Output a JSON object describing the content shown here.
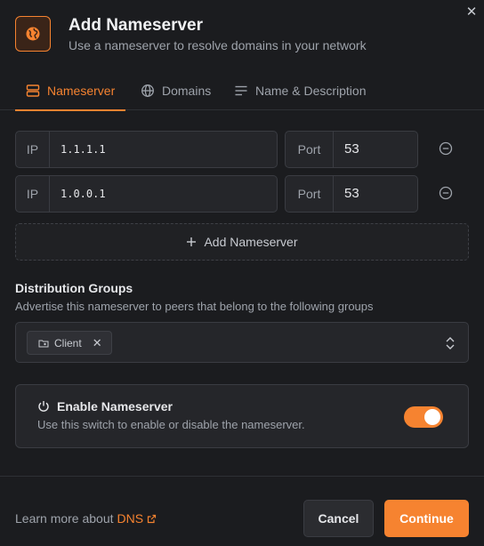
{
  "dialog": {
    "title": "Add Nameserver",
    "subtitle": "Use a nameserver to resolve domains in your network",
    "close_icon": "close-icon"
  },
  "tabs": [
    {
      "label": "Nameserver",
      "icon": "server-icon",
      "active": true
    },
    {
      "label": "Domains",
      "icon": "globe-icon",
      "active": false
    },
    {
      "label": "Name & Description",
      "icon": "text-lines-icon",
      "active": false
    }
  ],
  "nameservers": [
    {
      "ip_label": "IP",
      "ip": "1.1.1.1",
      "port_label": "Port",
      "port": "53"
    },
    {
      "ip_label": "IP",
      "ip": "1.0.0.1",
      "port_label": "Port",
      "port": "53"
    }
  ],
  "add_nameserver_label": "Add Nameserver",
  "distribution_groups": {
    "title": "Distribution Groups",
    "description": "Advertise this nameserver to peers that belong to the following groups",
    "selected": [
      {
        "label": "Client"
      }
    ]
  },
  "enable": {
    "title": "Enable Nameserver",
    "description": "Use this switch to enable or disable the nameserver.",
    "enabled": true
  },
  "footer": {
    "learn_prefix": "Learn more about",
    "learn_link": "DNS",
    "cancel_label": "Cancel",
    "continue_label": "Continue"
  },
  "colors": {
    "accent": "#f68330",
    "background": "#1b1c1f",
    "panel": "#25262a",
    "border": "#3a3c42"
  }
}
